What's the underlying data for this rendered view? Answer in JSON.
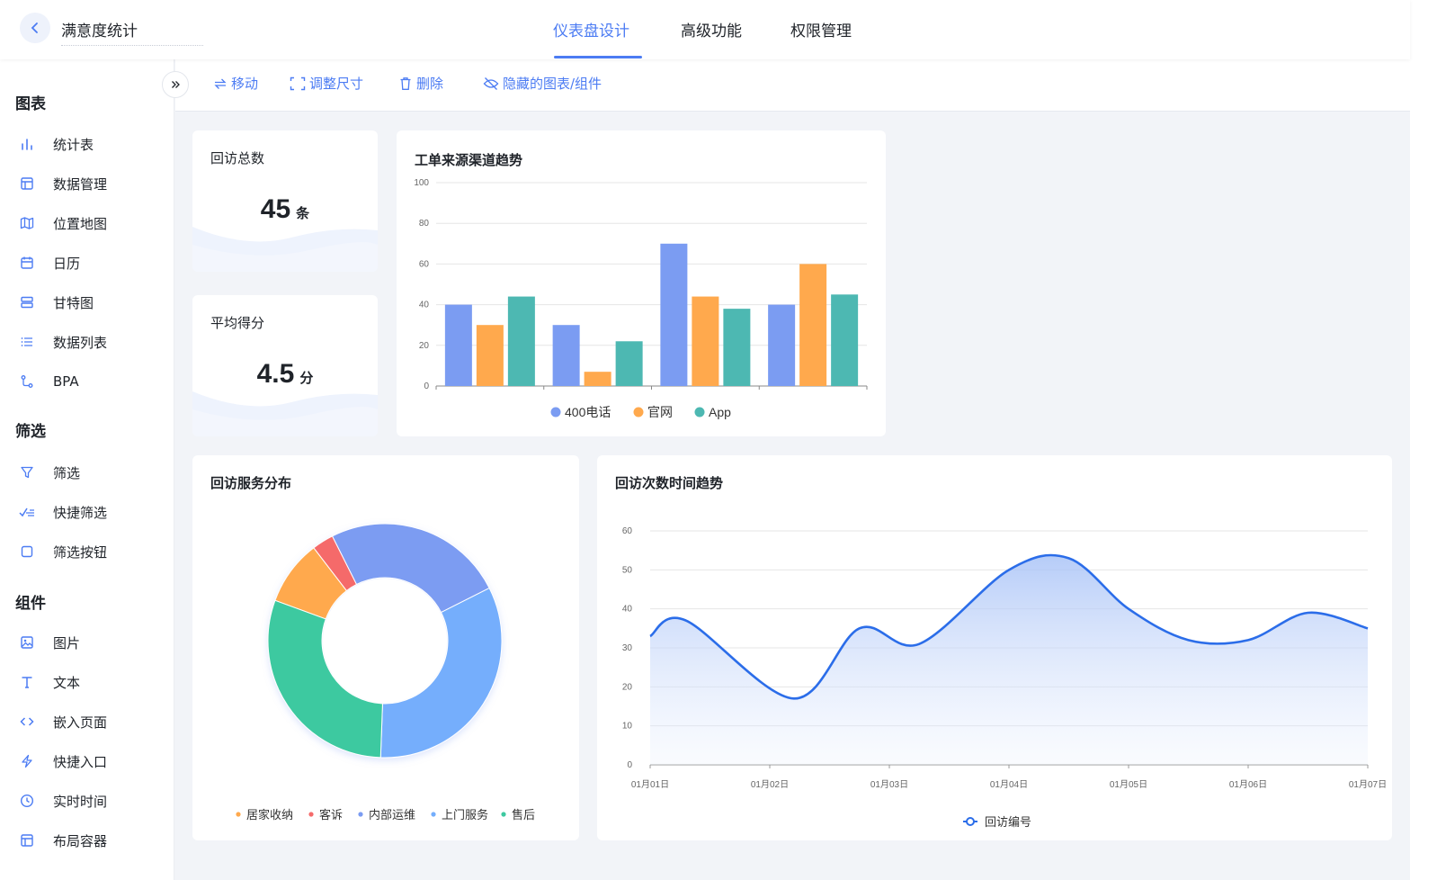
{
  "header": {
    "back_icon": "chevron-left-icon",
    "title": "满意度统计",
    "tabs": [
      {
        "label": "仪表盘设计",
        "active": true
      },
      {
        "label": "高级功能",
        "active": false
      },
      {
        "label": "权限管理",
        "active": false
      }
    ]
  },
  "toolbar": {
    "move": "移动",
    "resize": "调整尺寸",
    "delete": "删除",
    "hidden": "隐藏的图表/组件"
  },
  "sidebar": {
    "sections": [
      {
        "title": "图表",
        "items": [
          {
            "label": "统计表",
            "icon": "bar-chart-icon"
          },
          {
            "label": "数据管理",
            "icon": "table-icon"
          },
          {
            "label": "位置地图",
            "icon": "map-icon"
          },
          {
            "label": "日历",
            "icon": "calendar-icon"
          },
          {
            "label": "甘特图",
            "icon": "gantt-icon"
          },
          {
            "label": "数据列表",
            "icon": "list-icon"
          },
          {
            "label": "BPA",
            "icon": "flow-icon"
          }
        ]
      },
      {
        "title": "筛选",
        "items": [
          {
            "label": "筛选",
            "icon": "filter-icon"
          },
          {
            "label": "快捷筛选",
            "icon": "quick-filter-icon"
          },
          {
            "label": "筛选按钮",
            "icon": "checkbox-icon"
          }
        ]
      },
      {
        "title": "组件",
        "items": [
          {
            "label": "图片",
            "icon": "image-icon"
          },
          {
            "label": "文本",
            "icon": "text-icon"
          },
          {
            "label": "嵌入页面",
            "icon": "code-icon"
          },
          {
            "label": "快捷入口",
            "icon": "lightning-icon"
          },
          {
            "label": "实时时间",
            "icon": "clock-icon"
          },
          {
            "label": "布局容器",
            "icon": "layout-icon"
          }
        ]
      }
    ]
  },
  "cards": {
    "total": {
      "title": "回访总数",
      "value": "45",
      "unit": "条"
    },
    "avg": {
      "title": "平均得分",
      "value": "4.5",
      "unit": "分"
    },
    "bar_title": "工单来源渠道趋势",
    "pie_title": "回访服务分布",
    "line_title": "回访次数时间趋势"
  },
  "colors": {
    "accent": "#4c7cf3",
    "blue": "#7b9cf2",
    "orange": "#ffa94d",
    "teal": "#4db8b2",
    "red": "#f56b6b",
    "green": "#3ec9a0",
    "sky": "#74aefc",
    "line": "#2b6de9"
  },
  "chart_data": [
    {
      "type": "bar",
      "title": "工单来源渠道趋势",
      "categories": [
        "",
        "",
        "",
        ""
      ],
      "series": [
        {
          "name": "400电话",
          "values": [
            40,
            30,
            70,
            40
          ]
        },
        {
          "name": "官网",
          "values": [
            30,
            7,
            44,
            60
          ]
        },
        {
          "name": "App",
          "values": [
            44,
            22,
            38,
            45
          ]
        }
      ],
      "ylim": [
        0,
        100
      ],
      "yticks": [
        0,
        20,
        40,
        60,
        80,
        100
      ],
      "grid": true,
      "legend": "bottom"
    },
    {
      "type": "pie",
      "title": "回访服务分布",
      "donut": true,
      "slices": [
        {
          "name": "居家收纳",
          "value": 9
        },
        {
          "name": "客诉",
          "value": 3
        },
        {
          "name": "内部运维",
          "value": 25
        },
        {
          "name": "上门服务",
          "value": 33
        },
        {
          "name": "售后",
          "value": 30
        }
      ],
      "legend": "bottom"
    },
    {
      "type": "area",
      "title": "回访次数时间趋势",
      "x": [
        "01月01日",
        "01月02日",
        "01月03日",
        "01月04日",
        "01月05日",
        "01月06日",
        "01月07日"
      ],
      "series": [
        {
          "name": "回访编号",
          "points": [
            [
              0,
              33
            ],
            [
              0.3,
              37
            ],
            [
              1.2,
              17
            ],
            [
              1.75,
              35
            ],
            [
              2.25,
              31
            ],
            [
              3.0,
              50
            ],
            [
              3.5,
              53
            ],
            [
              4.0,
              40
            ],
            [
              4.5,
              32
            ],
            [
              5.0,
              32
            ],
            [
              5.5,
              39
            ],
            [
              6.0,
              35
            ]
          ]
        }
      ],
      "ylim": [
        0,
        60
      ],
      "yticks": [
        0,
        10,
        20,
        30,
        40,
        50,
        60
      ],
      "grid": true,
      "legend": "bottom"
    }
  ]
}
